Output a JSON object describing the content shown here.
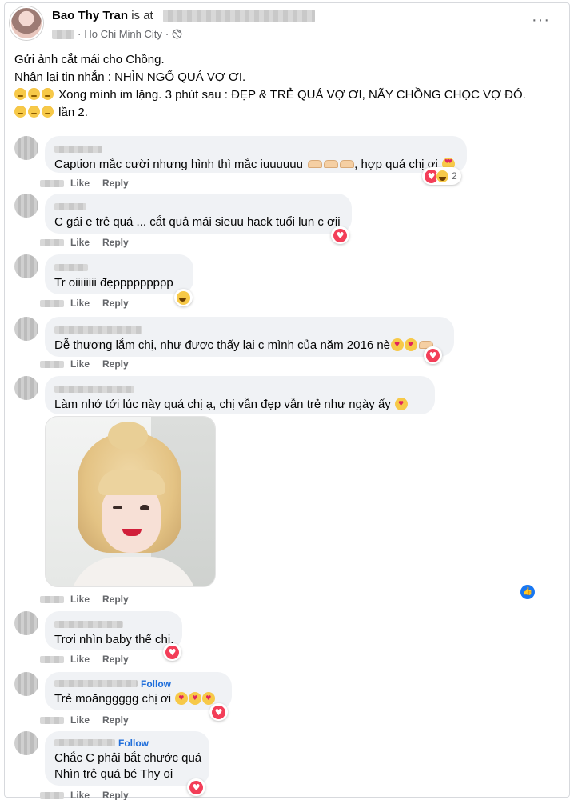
{
  "post": {
    "author": "Bao Thy Tran",
    "at_text": "is at",
    "location": "Ho Chi Minh City",
    "more_icon": "ellipsis-icon",
    "privacy_icon": "globe-icon",
    "lines": [
      "Gửi ảnh cắt mái cho Chồng.",
      "Nhận lại tin nhắn : NHÌN NGỐ QUÁ VỢ ƠI.",
      "Xong mình im lặng. 3 phút sau : ĐẸP & TRẺ QUÁ VỢ ƠI, NÃY CHỒNG CHỌC VỢ ĐÓ.",
      "lần 2."
    ]
  },
  "comments": [
    {
      "text": "Caption mắc cười nhưng hình thì mắc iuuuuuu",
      "text_tail": ", hợp quá chị ơi",
      "like": "Like",
      "reply": "Reply",
      "reaction_count": "2"
    },
    {
      "text": "C gái e trẻ quá ... cắt quả mái sieuu hack tuổi lun c ơii",
      "like": "Like",
      "reply": "Reply"
    },
    {
      "text": "Tr oiiiiiiii đẹppppppppp",
      "like": "Like",
      "reply": "Reply"
    },
    {
      "text": "Dễ thương lắm chị, như được thấy lại c mình của năm 2016 nè",
      "like": "Like",
      "reply": "Reply"
    },
    {
      "text": "Làm nhớ tới lúc này quá chị ạ, chị vẫn đẹp vẫn trẻ như ngày ấy",
      "like": "Like",
      "reply": "Reply"
    },
    {
      "text": "Trơi nhìn baby thế chị.",
      "like": "Like",
      "reply": "Reply"
    },
    {
      "text": "Trẻ moănggggg chị ơi",
      "follow": "Follow",
      "like": "Like",
      "reply": "Reply"
    },
    {
      "text": "Chắc C phải bắt chước quá",
      "text2": "Nhìn trẻ quá bé Thy oi",
      "follow": "Follow",
      "like": "Like",
      "reply": "Reply"
    }
  ],
  "colors": {
    "accent": "#216fdb",
    "heart": "#f33e58",
    "bubble": "#f0f2f5",
    "like_blue": "#1877f2"
  }
}
